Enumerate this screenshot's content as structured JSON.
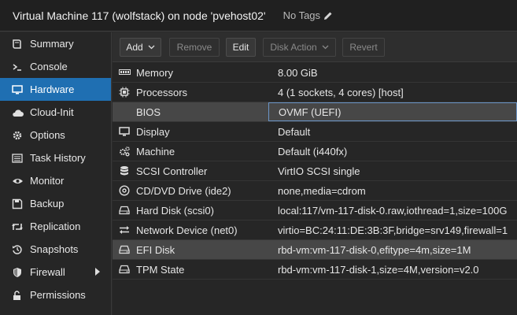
{
  "header": {
    "title": "Virtual Machine 117 (wolfstack) on node 'pvehost02'",
    "tags_label": "No Tags"
  },
  "sidebar": {
    "items": [
      {
        "label": "Summary",
        "icon": "book-icon"
      },
      {
        "label": "Console",
        "icon": "terminal-icon"
      },
      {
        "label": "Hardware",
        "icon": "monitor-icon",
        "active": true
      },
      {
        "label": "Cloud-Init",
        "icon": "cloud-icon"
      },
      {
        "label": "Options",
        "icon": "gear-icon"
      },
      {
        "label": "Task History",
        "icon": "list-icon"
      },
      {
        "label": "Monitor",
        "icon": "eye-icon"
      },
      {
        "label": "Backup",
        "icon": "floppy-icon"
      },
      {
        "label": "Replication",
        "icon": "retweet-icon"
      },
      {
        "label": "Snapshots",
        "icon": "history-icon"
      },
      {
        "label": "Firewall",
        "icon": "shield-icon"
      },
      {
        "label": "Permissions",
        "icon": "unlock-icon"
      }
    ]
  },
  "toolbar": {
    "add": "Add",
    "remove": "Remove",
    "edit": "Edit",
    "disk_action": "Disk Action",
    "revert": "Revert"
  },
  "hardware": {
    "rows": [
      {
        "name": "Memory",
        "value": "8.00 GiB",
        "icon": "memory-icon"
      },
      {
        "name": "Processors",
        "value": "4 (1 sockets, 4 cores) [host]",
        "icon": "cpu-icon"
      },
      {
        "name": "BIOS",
        "value": "OVMF (UEFI)",
        "icon": "none"
      },
      {
        "name": "Display",
        "value": "Default",
        "icon": "desktop-icon"
      },
      {
        "name": "Machine",
        "value": "Default (i440fx)",
        "icon": "cogs-icon"
      },
      {
        "name": "SCSI Controller",
        "value": "VirtIO SCSI single",
        "icon": "database-icon"
      },
      {
        "name": "CD/DVD Drive (ide2)",
        "value": "none,media=cdrom",
        "icon": "cdrom-icon"
      },
      {
        "name": "Hard Disk (scsi0)",
        "value": "local:117/vm-117-disk-0.raw,iothread=1,size=100G",
        "icon": "hdd-icon"
      },
      {
        "name": "Network Device (net0)",
        "value": "virtio=BC:24:11:DE:3B:3F,bridge=srv149,firewall=1",
        "icon": "exchange-icon"
      },
      {
        "name": "EFI Disk",
        "value": "rbd-vm:vm-117-disk-0,efitype=4m,size=1M",
        "icon": "hdd-icon"
      },
      {
        "name": "TPM State",
        "value": "rbd-vm:vm-117-disk-1,size=4M,version=v2.0",
        "icon": "hdd-icon"
      }
    ]
  }
}
